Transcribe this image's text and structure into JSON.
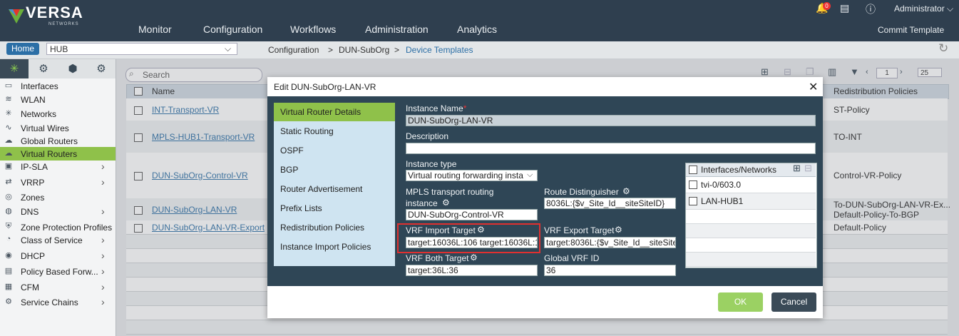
{
  "app": {
    "brand": "VERSA",
    "brand_sub": "NETWORKS",
    "notification_count": "0",
    "user": "Administrator",
    "commit": "Commit Template",
    "nav": [
      "Monitor",
      "Configuration",
      "Workflows",
      "Administration",
      "Analytics"
    ]
  },
  "breadcrumb": {
    "home": "Home",
    "org": "HUB",
    "path1": "Configuration",
    "sep": ">",
    "path2": "DUN-SubOrg",
    "path3": "Device Templates"
  },
  "sidebar": {
    "items": [
      {
        "label": "Interfaces",
        "icon": "interfaces-icon"
      },
      {
        "label": "WLAN",
        "icon": "wifi-icon"
      },
      {
        "label": "Networks",
        "icon": "network-icon"
      },
      {
        "label": "Virtual Wires",
        "icon": "wire-icon"
      },
      {
        "label": "Global Routers",
        "icon": "router-icon"
      },
      {
        "label": "Virtual Routers",
        "icon": "router-icon",
        "active": true
      },
      {
        "label": "IP-SLA",
        "icon": "sla-icon"
      },
      {
        "label": "VRRP",
        "icon": "vrrp-icon"
      },
      {
        "label": "Zones",
        "icon": "zones-icon"
      },
      {
        "label": "DNS",
        "icon": "dns-icon"
      },
      {
        "label": "Zone Protection Profiles",
        "icon": "shield-icon"
      },
      {
        "label": "Class of Service",
        "icon": "cos-icon"
      },
      {
        "label": "DHCP",
        "icon": "dhcp-icon"
      },
      {
        "label": "Policy Based Forw...",
        "icon": "pbf-icon"
      },
      {
        "label": "CFM",
        "icon": "cfm-icon"
      },
      {
        "label": "Service Chains",
        "icon": "gear-icon"
      }
    ]
  },
  "table": {
    "search_placeholder": "Search",
    "page": "1",
    "page_size": "25",
    "col_name": "Name",
    "col_redist": "Redistribution Policies",
    "rows": [
      {
        "name": "INT-Transport-VR",
        "redist": "ST-Policy",
        "redist2": ""
      },
      {
        "name": "MPLS-HUB1-Transport-VR",
        "redist": "TO-INT",
        "redist2": ""
      },
      {
        "name": "DUN-SubOrg-Control-VR",
        "redist": "Control-VR-Policy",
        "redist2": ""
      },
      {
        "name": "DUN-SubOrg-LAN-VR",
        "redist": "To-DUN-SubOrg-LAN-VR-Ex...",
        "redist2": "Default-Policy-To-BGP"
      },
      {
        "name": "DUN-SubOrg-LAN-VR-Export",
        "redist": "Default-Policy",
        "redist2": ""
      }
    ]
  },
  "modal": {
    "title": "Edit DUN-SubOrg-LAN-VR",
    "menu": [
      "Virtual Router Details",
      "Static Routing",
      "OSPF",
      "BGP",
      "Router Advertisement",
      "Prefix Lists",
      "Redistribution Policies",
      "Instance Import Policies"
    ],
    "instance_name_label": "Instance Name",
    "instance_name": "DUN-SubOrg-LAN-VR",
    "description_label": "Description",
    "description": "",
    "instance_type_label": "Instance type",
    "instance_type": "Virtual routing forwarding insta",
    "mpls_label_1": "MPLS transport routing",
    "mpls_label_2": "instance",
    "mpls_value": "DUN-SubOrg-Control-VR",
    "rd_label": "Route Distinguisher",
    "rd_value": "8036L:{$v_Site_Id__siteSiteID}",
    "vrf_import_label": "VRF Import Target",
    "vrf_import_value": "target:16036L:106 target:16036L:10",
    "vrf_export_label": "VRF Export Target",
    "vrf_export_value": "target:8036L:{$v_Site_Id__siteSiteID",
    "vrf_both_label": "VRF Both Target",
    "vrf_both_value": "target:36L:36",
    "global_vrf_label": "Global VRF ID",
    "global_vrf_value": "36",
    "interfaces_header": "Interfaces/Networks",
    "interfaces": [
      "tvi-0/603.0",
      "LAN-HUB1"
    ],
    "ok": "OK",
    "cancel": "Cancel"
  },
  "colors": {
    "header_bg": "#2f3f4f",
    "accent_green": "#8fc14a",
    "link_blue": "#2c6fa6",
    "highlight_red": "#e03030"
  }
}
